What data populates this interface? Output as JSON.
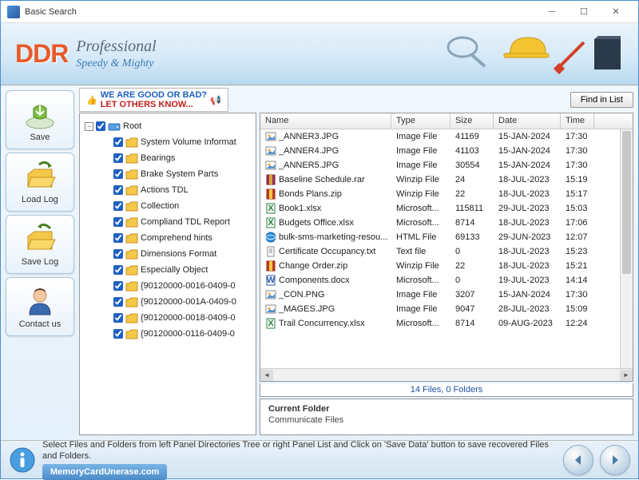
{
  "window": {
    "title": "Basic Search"
  },
  "banner": {
    "logo": "DDR",
    "professional": "Professional",
    "tagline": "Speedy & Mighty"
  },
  "sidebar": [
    {
      "label": "Save",
      "icon": "save"
    },
    {
      "label": "Load Log",
      "icon": "load"
    },
    {
      "label": "Save Log",
      "icon": "savelog"
    },
    {
      "label": "Contact us",
      "icon": "contact"
    }
  ],
  "rate": {
    "line1": "WE ARE GOOD OR BAD?",
    "line2": "LET OTHERS KNOW..."
  },
  "find_btn": "Find in List",
  "tree": {
    "root": "Root",
    "items": [
      "System Volume Informat",
      "Bearings",
      "Brake System Parts",
      "Actions TDL",
      "Collection",
      "Compliand TDL Report",
      "Comprehend hints",
      "Dimensions Format",
      "Especially Object",
      "{90120000-0016-0409-0",
      "{90120000-001A-0409-0",
      "{90120000-0018-0409-0",
      "{90120000-0116-0409-0"
    ]
  },
  "columns": {
    "name": "Name",
    "type": "Type",
    "size": "Size",
    "date": "Date",
    "time": "Time"
  },
  "files": [
    {
      "name": "_ANNER3.JPG",
      "type": "Image File",
      "size": "41169",
      "date": "15-JAN-2024",
      "time": "17:30",
      "icon": "img"
    },
    {
      "name": "_ANNER4.JPG",
      "type": "Image File",
      "size": "41103",
      "date": "15-JAN-2024",
      "time": "17:30",
      "icon": "img"
    },
    {
      "name": "_ANNER5.JPG",
      "type": "Image File",
      "size": "30554",
      "date": "15-JAN-2024",
      "time": "17:30",
      "icon": "img"
    },
    {
      "name": "Baseline Schedule.rar",
      "type": "Winzip File",
      "size": "24",
      "date": "18-JUL-2023",
      "time": "15:19",
      "icon": "rar"
    },
    {
      "name": "Bonds Plans.zip",
      "type": "Winzip File",
      "size": "22",
      "date": "18-JUL-2023",
      "time": "15:17",
      "icon": "zip"
    },
    {
      "name": "Book1.xlsx",
      "type": "Microsoft...",
      "size": "115811",
      "date": "29-JUL-2023",
      "time": "15:03",
      "icon": "xls"
    },
    {
      "name": "Budgets Office.xlsx",
      "type": "Microsoft...",
      "size": "8714",
      "date": "18-JUL-2023",
      "time": "17:06",
      "icon": "xls"
    },
    {
      "name": "bulk-sms-marketing-resou...",
      "type": "HTML File",
      "size": "69133",
      "date": "29-JUN-2023",
      "time": "12:07",
      "icon": "html"
    },
    {
      "name": "Certificate Occupancy.txt",
      "type": "Text file",
      "size": "0",
      "date": "18-JUL-2023",
      "time": "15:23",
      "icon": "txt"
    },
    {
      "name": "Change Order.zip",
      "type": "Winzip File",
      "size": "22",
      "date": "18-JUL-2023",
      "time": "15:21",
      "icon": "zip"
    },
    {
      "name": "Components.docx",
      "type": "Microsoft...",
      "size": "0",
      "date": "19-JUL-2023",
      "time": "14:14",
      "icon": "doc"
    },
    {
      "name": "_CON.PNG",
      "type": "Image File",
      "size": "3207",
      "date": "15-JAN-2024",
      "time": "17:30",
      "icon": "img"
    },
    {
      "name": "_MAGES.JPG",
      "type": "Image File",
      "size": "9047",
      "date": "28-JUL-2023",
      "time": "15:09",
      "icon": "img"
    },
    {
      "name": "Trail Concurrency.xlsx",
      "type": "Microsoft...",
      "size": "8714",
      "date": "09-AUG-2023",
      "time": "12:24",
      "icon": "xls"
    }
  ],
  "status_count": "14 Files, 0 Folders",
  "current_folder": {
    "title": "Current Folder",
    "name": "Communicate Files"
  },
  "footer": {
    "text": "Select Files and Folders from left Panel Directories Tree or right Panel List and Click on 'Save Data' button to save recovered Files and Folders.",
    "link": "MemoryCardUnerase.com"
  }
}
